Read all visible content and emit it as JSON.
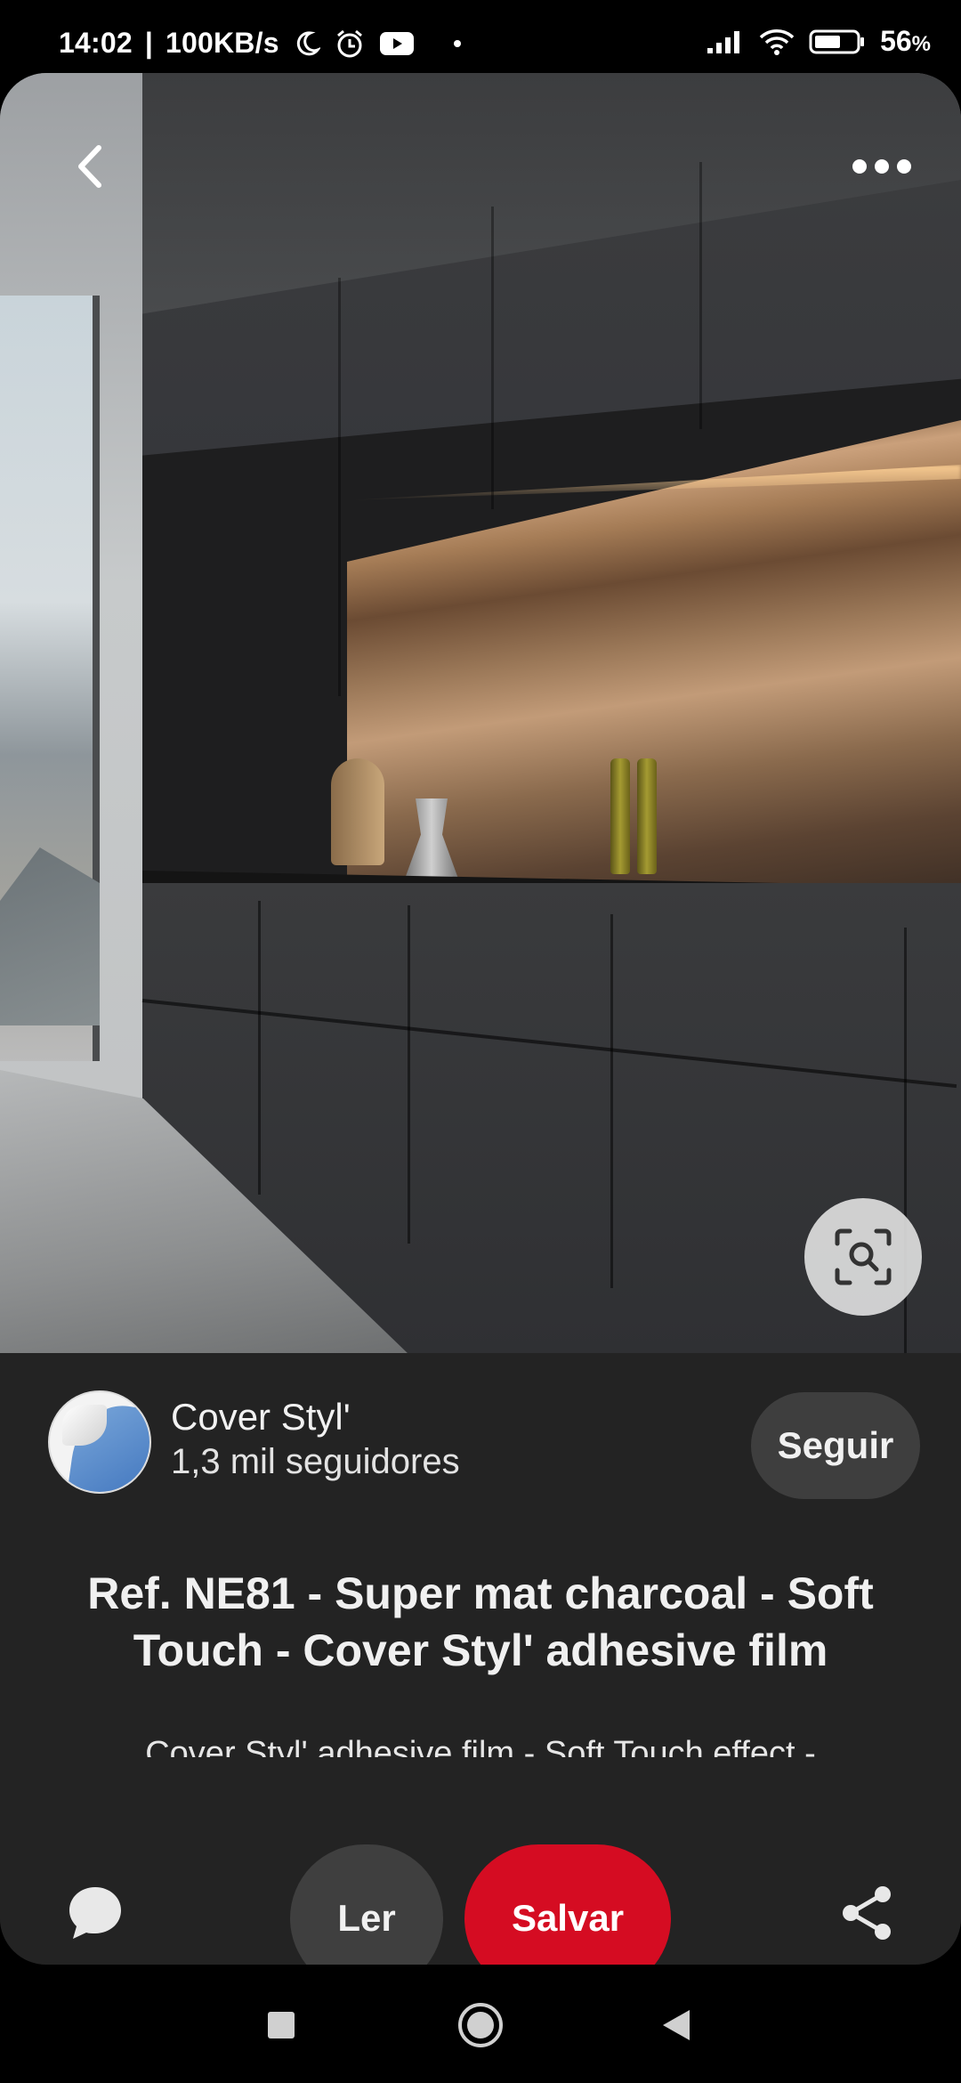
{
  "status_bar": {
    "time": "14:02",
    "network_speed": "100KB/s",
    "battery_percent": "56",
    "battery_unit": "%",
    "icons": [
      "moon-icon",
      "alarm-icon",
      "youtube-icon",
      "signal-icon",
      "wifi-icon",
      "battery-icon"
    ]
  },
  "pin": {
    "title": "Ref. NE81 - Super mat charcoal - Soft Touch - Cover Styl' adhesive film",
    "description": "Cover Styl' adhesive film - Soft Touch effect -"
  },
  "creator": {
    "name": "Cover Styl'",
    "followers": "1,3 mil seguidores",
    "follow_label": "Seguir"
  },
  "actions": {
    "read_label": "Ler",
    "save_label": "Salvar"
  },
  "colors": {
    "card_background": "#232323",
    "save_button": "#d50c22",
    "secondary_button": "#3f3f3f"
  }
}
